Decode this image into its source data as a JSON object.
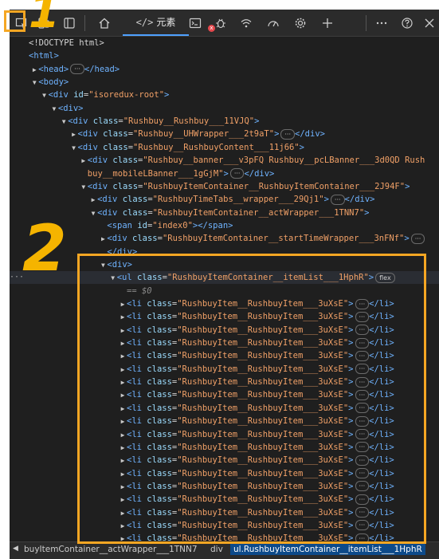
{
  "toolbar": {
    "tabs": [
      {
        "label": "元素",
        "prefix": "</>"
      }
    ],
    "icons": [
      "inspect-icon",
      "device-icon",
      "sidebar-icon",
      "home-icon",
      "console-icon",
      "bug-icon",
      "wifi-icon",
      "performance-icon",
      "settings-gear-icon",
      "plus-icon",
      "more-icon",
      "help-icon",
      "close-icon"
    ],
    "error_badge": "x"
  },
  "dom_tree": {
    "rows": [
      {
        "indent": 0,
        "tri": "",
        "parts": [
          [
            "txt",
            "<!DOCTYPE html>"
          ]
        ]
      },
      {
        "indent": 0,
        "tri": "",
        "parts": [
          [
            "tag",
            "<html>"
          ]
        ]
      },
      {
        "indent": 1,
        "tri": "▶",
        "parts": [
          [
            "tag",
            "<head>"
          ],
          [
            "pill",
            "···"
          ],
          [
            "tag",
            "</head>"
          ]
        ]
      },
      {
        "indent": 1,
        "tri": "▼",
        "parts": [
          [
            "tag",
            "<body>"
          ]
        ]
      },
      {
        "indent": 2,
        "tri": "▼",
        "parts": [
          [
            "tag",
            "<div "
          ],
          [
            "attr",
            "id"
          ],
          [
            "txt",
            "="
          ],
          [
            "val",
            "\"isoredux-root\""
          ],
          [
            "tag",
            ">"
          ]
        ]
      },
      {
        "indent": 3,
        "tri": "▼",
        "parts": [
          [
            "tag",
            "<div>"
          ]
        ]
      },
      {
        "indent": 4,
        "tri": "▼",
        "parts": [
          [
            "tag",
            "<div "
          ],
          [
            "attr",
            "class"
          ],
          [
            "txt",
            "="
          ],
          [
            "val",
            "\"Rushbuy__Rushbuy___11VJQ\""
          ],
          [
            "tag",
            ">"
          ]
        ]
      },
      {
        "indent": 5,
        "tri": "▶",
        "parts": [
          [
            "tag",
            "<div "
          ],
          [
            "attr",
            "class"
          ],
          [
            "txt",
            "="
          ],
          [
            "val",
            "\"Rushbuy__UHWrapper___2t9aT\""
          ],
          [
            "tag",
            ">"
          ],
          [
            "pill",
            "···"
          ],
          [
            "tag",
            "</div>"
          ]
        ]
      },
      {
        "indent": 5,
        "tri": "▼",
        "parts": [
          [
            "tag",
            "<div "
          ],
          [
            "attr",
            "class"
          ],
          [
            "txt",
            "="
          ],
          [
            "val",
            "\"Rushbuy__RushbuyContent___11j66\""
          ],
          [
            "tag",
            ">"
          ]
        ]
      },
      {
        "indent": 6,
        "tri": "▶",
        "parts": [
          [
            "tag",
            "<div "
          ],
          [
            "attr",
            "class"
          ],
          [
            "txt",
            "="
          ],
          [
            "val",
            "\"Rushbuy__banner___v3pFQ Rushbuy__pcLBanner___3d0QD Rush"
          ]
        ]
      },
      {
        "indent": 6,
        "tri": "",
        "parts": [
          [
            "val",
            "buy__mobileLBanner___1gGjM\""
          ],
          [
            "tag",
            ">"
          ],
          [
            "pill",
            "···"
          ],
          [
            "tag",
            "</div>"
          ]
        ]
      },
      {
        "indent": 6,
        "tri": "▼",
        "parts": [
          [
            "tag",
            "<div "
          ],
          [
            "attr",
            "class"
          ],
          [
            "txt",
            "="
          ],
          [
            "val",
            "\"RushbuyItemContainer__RushbuyItemContainer___2J94F\""
          ],
          [
            "tag",
            ">"
          ]
        ]
      },
      {
        "indent": 7,
        "tri": "▶",
        "parts": [
          [
            "tag",
            "<div "
          ],
          [
            "attr",
            "class"
          ],
          [
            "txt",
            "="
          ],
          [
            "val",
            "\"RushbuyTimeTabs__wrapper___29Qj1\""
          ],
          [
            "tag",
            ">"
          ],
          [
            "pill",
            "···"
          ],
          [
            "tag",
            "</div>"
          ]
        ]
      },
      {
        "indent": 7,
        "tri": "▼",
        "parts": [
          [
            "tag",
            "<div "
          ],
          [
            "attr",
            "class"
          ],
          [
            "txt",
            "="
          ],
          [
            "val",
            "\"RushbuyItemContainer__actWrapper___1TNN7\""
          ],
          [
            "tag",
            ">"
          ]
        ]
      },
      {
        "indent": 8,
        "tri": "",
        "parts": [
          [
            "tag",
            "<span "
          ],
          [
            "attr",
            "id"
          ],
          [
            "txt",
            "="
          ],
          [
            "val",
            "\"index0\""
          ],
          [
            "tag",
            "></span>"
          ]
        ]
      },
      {
        "indent": 8,
        "tri": "▶",
        "parts": [
          [
            "tag",
            "<div "
          ],
          [
            "attr",
            "class"
          ],
          [
            "txt",
            "="
          ],
          [
            "val",
            "\"RushbuyItemContainer__startTimeWrapper___3nFNf\""
          ],
          [
            "tag",
            ">"
          ],
          [
            "pill",
            "···"
          ]
        ]
      },
      {
        "indent": 8,
        "tri": "",
        "parts": [
          [
            "tag",
            "</div>"
          ]
        ]
      },
      {
        "indent": 8,
        "tri": "▼",
        "parts": [
          [
            "tag",
            "<div>"
          ]
        ]
      },
      {
        "indent": 9,
        "tri": "▼",
        "parts": [
          [
            "tag",
            "<ul "
          ],
          [
            "attr",
            "class"
          ],
          [
            "txt",
            "="
          ],
          [
            "val",
            "\"RushbuyItemContainer__itemList___1HphR\""
          ],
          [
            "tag",
            ">"
          ],
          [
            "pill",
            "flex"
          ]
        ],
        "highlight": true
      },
      {
        "indent": 10,
        "tri": "",
        "parts": [
          [
            "dollar",
            "== $0"
          ]
        ]
      },
      {
        "indent": 10,
        "tri": "▶",
        "parts": [
          [
            "tag",
            "<li "
          ],
          [
            "attr",
            "class"
          ],
          [
            "txt",
            "="
          ],
          [
            "val",
            "\"RushbuyItem__RushbuyItem___3uXsE\""
          ],
          [
            "tag",
            ">"
          ],
          [
            "pill",
            "···"
          ],
          [
            "tag",
            "</li>"
          ]
        ]
      },
      {
        "indent": 10,
        "tri": "▶",
        "parts": [
          [
            "tag",
            "<li "
          ],
          [
            "attr",
            "class"
          ],
          [
            "txt",
            "="
          ],
          [
            "val",
            "\"RushbuyItem__RushbuyItem___3uXsE\""
          ],
          [
            "tag",
            ">"
          ],
          [
            "pill",
            "···"
          ],
          [
            "tag",
            "</li>"
          ]
        ]
      },
      {
        "indent": 10,
        "tri": "▶",
        "parts": [
          [
            "tag",
            "<li "
          ],
          [
            "attr",
            "class"
          ],
          [
            "txt",
            "="
          ],
          [
            "val",
            "\"RushbuyItem__RushbuyItem___3uXsE\""
          ],
          [
            "tag",
            ">"
          ],
          [
            "pill",
            "···"
          ],
          [
            "tag",
            "</li>"
          ]
        ]
      },
      {
        "indent": 10,
        "tri": "▶",
        "parts": [
          [
            "tag",
            "<li "
          ],
          [
            "attr",
            "class"
          ],
          [
            "txt",
            "="
          ],
          [
            "val",
            "\"RushbuyItem__RushbuyItem___3uXsE\""
          ],
          [
            "tag",
            ">"
          ],
          [
            "pill",
            "···"
          ],
          [
            "tag",
            "</li>"
          ]
        ]
      },
      {
        "indent": 10,
        "tri": "▶",
        "parts": [
          [
            "tag",
            "<li "
          ],
          [
            "attr",
            "class"
          ],
          [
            "txt",
            "="
          ],
          [
            "val",
            "\"RushbuyItem__RushbuyItem___3uXsE\""
          ],
          [
            "tag",
            ">"
          ],
          [
            "pill",
            "···"
          ],
          [
            "tag",
            "</li>"
          ]
        ]
      },
      {
        "indent": 10,
        "tri": "▶",
        "parts": [
          [
            "tag",
            "<li "
          ],
          [
            "attr",
            "class"
          ],
          [
            "txt",
            "="
          ],
          [
            "val",
            "\"RushbuyItem__RushbuyItem___3uXsE\""
          ],
          [
            "tag",
            ">"
          ],
          [
            "pill",
            "···"
          ],
          [
            "tag",
            "</li>"
          ]
        ]
      },
      {
        "indent": 10,
        "tri": "▶",
        "parts": [
          [
            "tag",
            "<li "
          ],
          [
            "attr",
            "class"
          ],
          [
            "txt",
            "="
          ],
          [
            "val",
            "\"RushbuyItem__RushbuyItem___3uXsE\""
          ],
          [
            "tag",
            ">"
          ],
          [
            "pill",
            "···"
          ],
          [
            "tag",
            "</li>"
          ]
        ]
      },
      {
        "indent": 10,
        "tri": "▶",
        "parts": [
          [
            "tag",
            "<li "
          ],
          [
            "attr",
            "class"
          ],
          [
            "txt",
            "="
          ],
          [
            "val",
            "\"RushbuyItem__RushbuyItem___3uXsE\""
          ],
          [
            "tag",
            ">"
          ],
          [
            "pill",
            "···"
          ],
          [
            "tag",
            "</li>"
          ]
        ]
      },
      {
        "indent": 10,
        "tri": "▶",
        "parts": [
          [
            "tag",
            "<li "
          ],
          [
            "attr",
            "class"
          ],
          [
            "txt",
            "="
          ],
          [
            "val",
            "\"RushbuyItem__RushbuyItem___3uXsE\""
          ],
          [
            "tag",
            ">"
          ],
          [
            "pill",
            "···"
          ],
          [
            "tag",
            "</li>"
          ]
        ]
      },
      {
        "indent": 10,
        "tri": "▶",
        "parts": [
          [
            "tag",
            "<li "
          ],
          [
            "attr",
            "class"
          ],
          [
            "txt",
            "="
          ],
          [
            "val",
            "\"RushbuyItem__RushbuyItem___3uXsE\""
          ],
          [
            "tag",
            ">"
          ],
          [
            "pill",
            "···"
          ],
          [
            "tag",
            "</li>"
          ]
        ]
      },
      {
        "indent": 10,
        "tri": "▶",
        "parts": [
          [
            "tag",
            "<li "
          ],
          [
            "attr",
            "class"
          ],
          [
            "txt",
            "="
          ],
          [
            "val",
            "\"RushbuyItem__RushbuyItem___3uXsE\""
          ],
          [
            "tag",
            ">"
          ],
          [
            "pill",
            "···"
          ],
          [
            "tag",
            "</li>"
          ]
        ]
      },
      {
        "indent": 10,
        "tri": "▶",
        "parts": [
          [
            "tag",
            "<li "
          ],
          [
            "attr",
            "class"
          ],
          [
            "txt",
            "="
          ],
          [
            "val",
            "\"RushbuyItem__RushbuyItem___3uXsE\""
          ],
          [
            "tag",
            ">"
          ],
          [
            "pill",
            "···"
          ],
          [
            "tag",
            "</li>"
          ]
        ]
      },
      {
        "indent": 10,
        "tri": "▶",
        "parts": [
          [
            "tag",
            "<li "
          ],
          [
            "attr",
            "class"
          ],
          [
            "txt",
            "="
          ],
          [
            "val",
            "\"RushbuyItem__RushbuyItem___3uXsE\""
          ],
          [
            "tag",
            ">"
          ],
          [
            "pill",
            "···"
          ],
          [
            "tag",
            "</li>"
          ]
        ]
      },
      {
        "indent": 10,
        "tri": "▶",
        "parts": [
          [
            "tag",
            "<li "
          ],
          [
            "attr",
            "class"
          ],
          [
            "txt",
            "="
          ],
          [
            "val",
            "\"RushbuyItem__RushbuyItem___3uXsE\""
          ],
          [
            "tag",
            ">"
          ],
          [
            "pill",
            "···"
          ],
          [
            "tag",
            "</li>"
          ]
        ]
      },
      {
        "indent": 10,
        "tri": "▶",
        "parts": [
          [
            "tag",
            "<li "
          ],
          [
            "attr",
            "class"
          ],
          [
            "txt",
            "="
          ],
          [
            "val",
            "\"RushbuyItem__RushbuyItem___3uXsE\""
          ],
          [
            "tag",
            ">"
          ],
          [
            "pill",
            "···"
          ],
          [
            "tag",
            "</li>"
          ]
        ]
      },
      {
        "indent": 10,
        "tri": "▶",
        "parts": [
          [
            "tag",
            "<li "
          ],
          [
            "attr",
            "class"
          ],
          [
            "txt",
            "="
          ],
          [
            "val",
            "\"RushbuyItem__RushbuyItem___3uXsE\""
          ],
          [
            "tag",
            ">"
          ],
          [
            "pill",
            "···"
          ],
          [
            "tag",
            "</li>"
          ]
        ]
      },
      {
        "indent": 10,
        "tri": "▶",
        "parts": [
          [
            "tag",
            "<li "
          ],
          [
            "attr",
            "class"
          ],
          [
            "txt",
            "="
          ],
          [
            "val",
            "\"RushbuyItem__RushbuyItem___3uXsE\""
          ],
          [
            "tag",
            ">"
          ],
          [
            "pill",
            "···"
          ],
          [
            "tag",
            "</li>"
          ]
        ]
      },
      {
        "indent": 10,
        "tri": "▶",
        "parts": [
          [
            "tag",
            "<li "
          ],
          [
            "attr",
            "class"
          ],
          [
            "txt",
            "="
          ],
          [
            "val",
            "\"RushbuyItem__RushbuyItem___3uXsE\""
          ],
          [
            "tag",
            ">"
          ],
          [
            "pill",
            "···"
          ],
          [
            "tag",
            "</li>"
          ]
        ]
      },
      {
        "indent": 10,
        "tri": "▶",
        "parts": [
          [
            "tag",
            "<li "
          ],
          [
            "attr",
            "class"
          ],
          [
            "txt",
            "="
          ],
          [
            "val",
            "\"RushbuyItem__RushbuyItem___3uXsE\""
          ],
          [
            "tag",
            ">"
          ],
          [
            "pill",
            "···"
          ],
          [
            "tag",
            "</li>"
          ]
        ]
      }
    ]
  },
  "breadcrumb": {
    "items": [
      "buyItemContainer__actWrapper___1TNN7",
      "div",
      "ul.RushbuyItemContainer__itemList___1HphR"
    ]
  },
  "annotations": {
    "label_1": "1",
    "label_2": "2"
  },
  "colors": {
    "annotation": "#f5a623",
    "tag": "#6fb3ff",
    "attr": "#9cdcfe",
    "value": "#f0a067"
  }
}
